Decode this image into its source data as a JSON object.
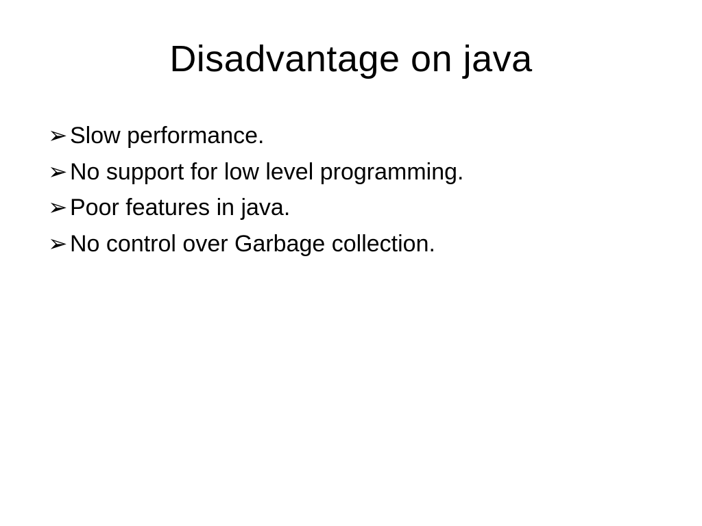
{
  "slide": {
    "title": "Disadvantage on java",
    "bullets": [
      "Slow performance.",
      "No support for low level programming.",
      "Poor features in java.",
      "No control over Garbage collection."
    ],
    "bullet_glyph": "➢"
  }
}
